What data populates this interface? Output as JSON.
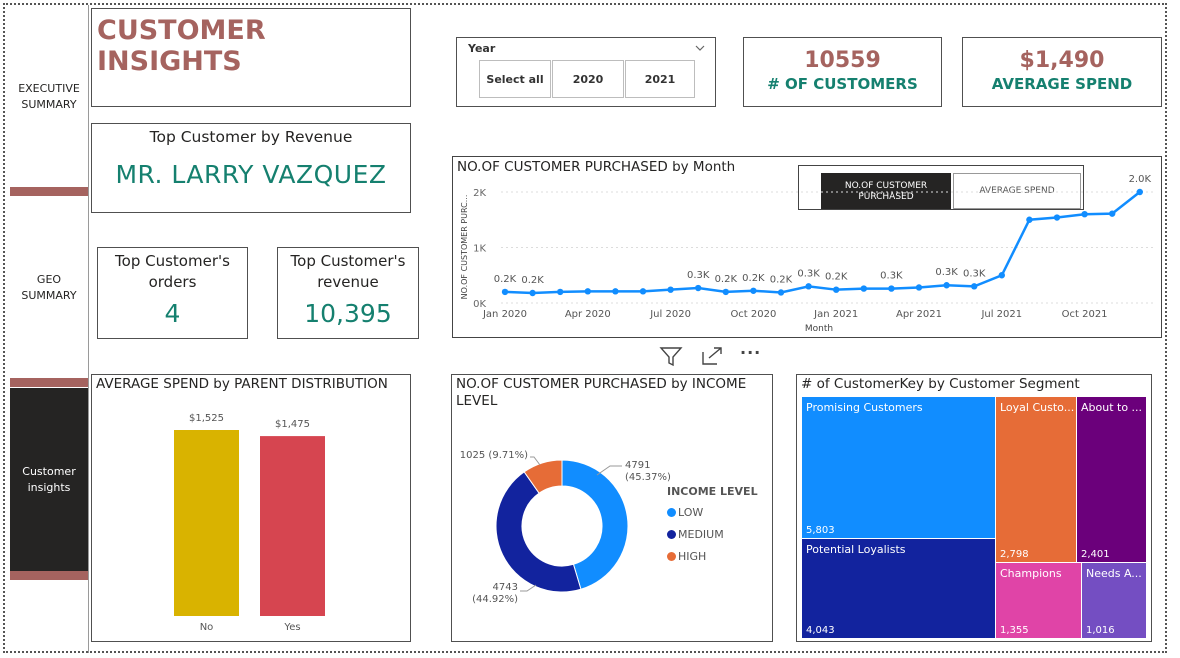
{
  "nav": {
    "items": [
      {
        "label": "EXECUTIVE SUMMARY"
      },
      {
        "label": "GEO SUMMARY"
      },
      {
        "label": "Customer insights"
      }
    ]
  },
  "header": {
    "title": "CUSTOMER INSIGHTS"
  },
  "slicer": {
    "label": "Year",
    "options": [
      "Select all",
      "2020",
      "2021"
    ]
  },
  "kpis": [
    {
      "value": "10559",
      "label": "# OF CUSTOMERS"
    },
    {
      "value": "$1,490",
      "label": "AVERAGE SPEND"
    }
  ],
  "top_customer": {
    "title": "Top Customer by Revenue",
    "name": "MR. LARRY VAZQUEZ"
  },
  "orders_card": {
    "title": "Top Customer's orders",
    "value": "4"
  },
  "revenue_card": {
    "title": "Top Customer's revenue",
    "value": "10,395"
  },
  "line_visual": {
    "title": "NO.OF CUSTOMER PURCHASED by Month",
    "toggle": [
      "NO.OF CUSTOMER PURCHASED",
      "AVERAGE SPEND"
    ],
    "ylabel": "NO.OF CUSTOMER PURC...",
    "xlabel": "Month",
    "yticks": [
      "2K",
      "1K",
      "0K"
    ],
    "xticks": [
      "Jan 2020",
      "Apr 2020",
      "Jul 2020",
      "Oct 2020",
      "Jan 2021",
      "Apr 2021",
      "Jul 2021",
      "Oct 2021"
    ]
  },
  "toolbar": {
    "icons": [
      "filter-icon",
      "focus-mode-icon",
      "more-options-icon"
    ],
    "more_label": "···"
  },
  "bar_visual": {
    "title": "AVERAGE SPEND by PARENT DISTRIBUTION"
  },
  "donut_visual": {
    "title": "NO.OF CUSTOMER PURCHASED by INCOME LEVEL",
    "legend_title": "INCOME LEVEL"
  },
  "treemap_visual": {
    "title": "# of CustomerKey by Customer Segment",
    "cells": [
      {
        "label": "Promising Customers",
        "value": "5,803",
        "color": "#118dff"
      },
      {
        "label": "Potential Loyalists",
        "value": "4,043",
        "color": "#12239e"
      },
      {
        "label": "Loyal Custo...",
        "value": "2,798",
        "color": "#e66c37"
      },
      {
        "label": "About to ...",
        "value": "2,401",
        "color": "#6b007b"
      },
      {
        "label": "Champions",
        "value": "1,355",
        "color": "#e044a7"
      },
      {
        "label": "Needs A...",
        "value": "1,016",
        "color": "#744ec2"
      }
    ]
  },
  "colors": {
    "brand": "#a5635f",
    "teal": "#15806f",
    "line": "#118dff"
  },
  "chart_data": [
    {
      "type": "line",
      "x": [
        "2020-01",
        "2020-02",
        "2020-03",
        "2020-04",
        "2020-05",
        "2020-06",
        "2020-07",
        "2020-08",
        "2020-09",
        "2020-10",
        "2020-11",
        "2020-12",
        "2021-01",
        "2021-02",
        "2021-03",
        "2021-04",
        "2021-05",
        "2021-06",
        "2021-07",
        "2021-08",
        "2021-09",
        "2021-10",
        "2021-11",
        "2021-12"
      ],
      "values": [
        200,
        180,
        200,
        210,
        210,
        210,
        240,
        270,
        200,
        220,
        190,
        300,
        240,
        260,
        260,
        280,
        320,
        300,
        500,
        1500,
        1540,
        1600,
        1610,
        2000
      ],
      "data_labels": [
        "0.2K",
        "0.2K",
        "",
        "",
        "",
        "",
        "",
        "0.3K",
        "0.2K",
        "0.2K",
        "0.2K",
        "0.3K",
        "0.2K",
        "",
        "0.3K",
        "",
        "0.3K",
        "0.3K",
        "",
        "",
        "",
        "",
        "",
        "2.0K"
      ],
      "ylim": [
        0,
        2000
      ]
    },
    {
      "type": "bar",
      "categories": [
        "No",
        "Yes"
      ],
      "values": [
        1525,
        1475
      ],
      "data_labels": [
        "$1,525",
        "$1,475"
      ],
      "colors": [
        "#d9b300",
        "#d64550"
      ]
    },
    {
      "type": "pie",
      "categories": [
        "LOW",
        "MEDIUM",
        "HIGH"
      ],
      "values": [
        4791,
        4743,
        1025
      ],
      "labels": [
        "4791 (45.37%)",
        "4743 (44.92%)",
        "1025 (9.71%)"
      ],
      "colors": [
        "#118dff",
        "#12239e",
        "#e66c37"
      ]
    }
  ]
}
